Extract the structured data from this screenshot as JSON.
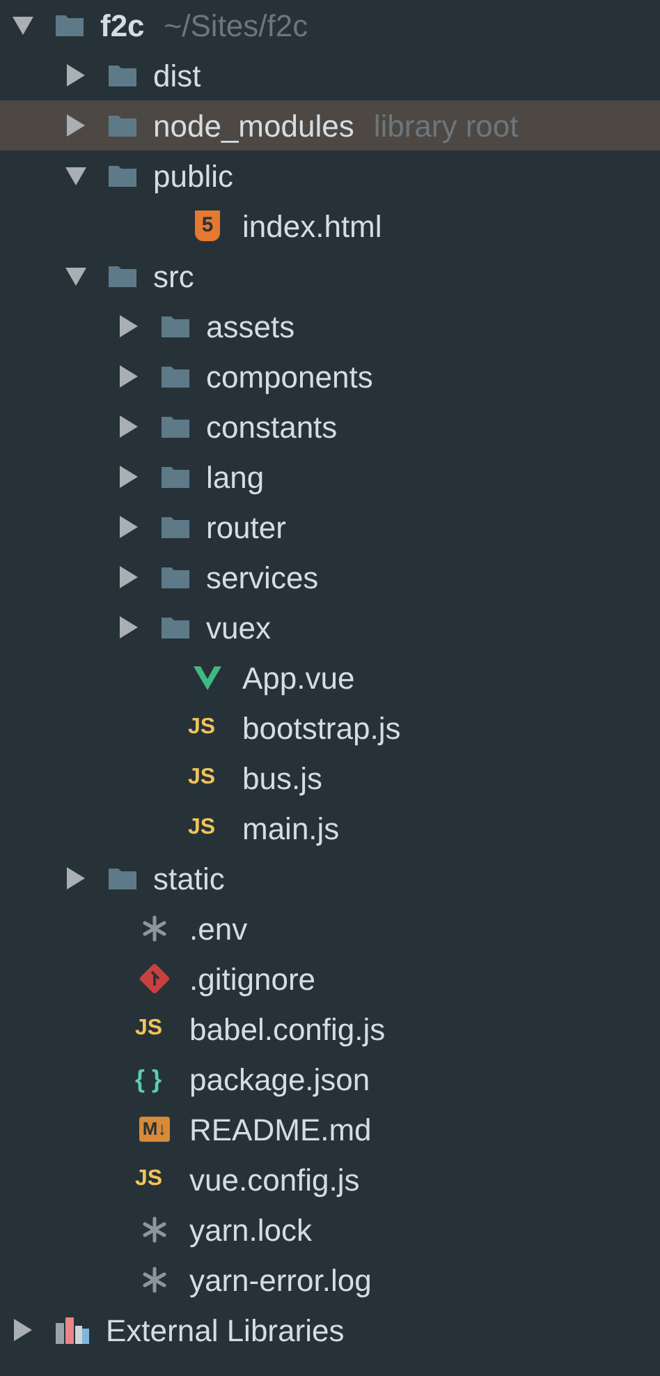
{
  "tree": [
    {
      "label": "f2c",
      "kind": "project",
      "hint": "~/Sites/f2c",
      "expanded": true,
      "selected": false,
      "children": [
        {
          "label": "dist",
          "kind": "folder",
          "expanded": false,
          "selected": false
        },
        {
          "label": "node_modules",
          "kind": "folder",
          "hint": "library root",
          "expanded": false,
          "selected": true
        },
        {
          "label": "public",
          "kind": "folder",
          "expanded": true,
          "selected": false,
          "children": [
            {
              "label": "index.html",
              "kind": "html",
              "icon_text": "5",
              "selected": false
            }
          ]
        },
        {
          "label": "src",
          "kind": "folder",
          "expanded": true,
          "selected": false,
          "children": [
            {
              "label": "assets",
              "kind": "folder",
              "expanded": false,
              "selected": false
            },
            {
              "label": "components",
              "kind": "folder",
              "expanded": false,
              "selected": false
            },
            {
              "label": "constants",
              "kind": "folder",
              "expanded": false,
              "selected": false
            },
            {
              "label": "lang",
              "kind": "folder",
              "expanded": false,
              "selected": false
            },
            {
              "label": "router",
              "kind": "folder",
              "expanded": false,
              "selected": false
            },
            {
              "label": "services",
              "kind": "folder",
              "expanded": false,
              "selected": false
            },
            {
              "label": "vuex",
              "kind": "folder",
              "expanded": false,
              "selected": false
            },
            {
              "label": "App.vue",
              "kind": "vue",
              "selected": false
            },
            {
              "label": "bootstrap.js",
              "kind": "js",
              "icon_text": "JS",
              "selected": false
            },
            {
              "label": "bus.js",
              "kind": "js",
              "icon_text": "JS",
              "selected": false
            },
            {
              "label": "main.js",
              "kind": "js",
              "icon_text": "JS",
              "selected": false
            }
          ]
        },
        {
          "label": "static",
          "kind": "folder",
          "expanded": false,
          "selected": false
        },
        {
          "label": ".env",
          "kind": "text",
          "selected": false
        },
        {
          "label": ".gitignore",
          "kind": "git",
          "selected": false
        },
        {
          "label": "babel.config.js",
          "kind": "js",
          "icon_text": "JS",
          "selected": false
        },
        {
          "label": "package.json",
          "kind": "json",
          "icon_text": "{ }",
          "selected": false
        },
        {
          "label": "README.md",
          "kind": "md",
          "icon_text": "M↓",
          "selected": false
        },
        {
          "label": "vue.config.js",
          "kind": "js",
          "icon_text": "JS",
          "selected": false
        },
        {
          "label": "yarn.lock",
          "kind": "text",
          "selected": false
        },
        {
          "label": "yarn-error.log",
          "kind": "text",
          "selected": false
        }
      ]
    },
    {
      "label": "External Libraries",
      "kind": "library",
      "expanded": false,
      "selected": false
    }
  ]
}
